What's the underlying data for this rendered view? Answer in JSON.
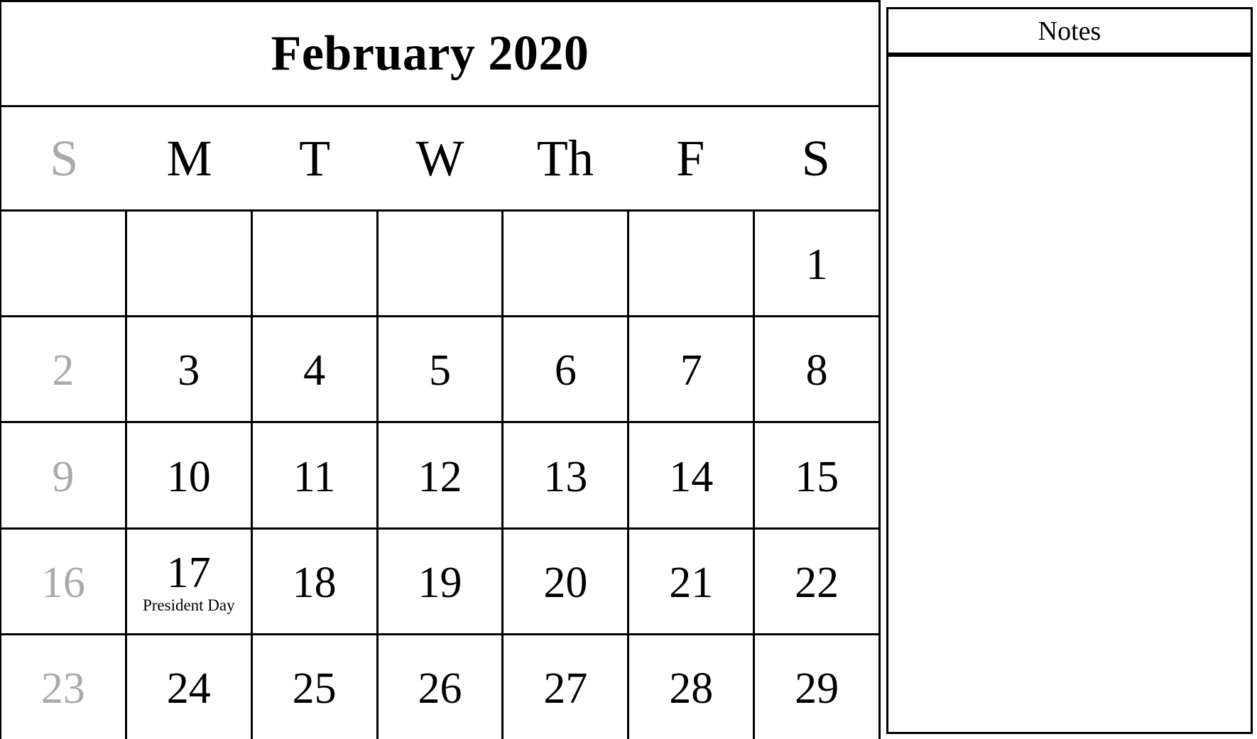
{
  "calendar": {
    "title": "February 2020",
    "weekdays": [
      {
        "label": "S",
        "weekend": true
      },
      {
        "label": "M",
        "weekend": false
      },
      {
        "label": "T",
        "weekend": false
      },
      {
        "label": "W",
        "weekend": false
      },
      {
        "label": "Th",
        "weekend": false
      },
      {
        "label": "F",
        "weekend": false
      },
      {
        "label": "S",
        "weekend": false
      }
    ],
    "weeks": [
      [
        {
          "day": ""
        },
        {
          "day": ""
        },
        {
          "day": ""
        },
        {
          "day": ""
        },
        {
          "day": ""
        },
        {
          "day": ""
        },
        {
          "day": "1"
        }
      ],
      [
        {
          "day": "2"
        },
        {
          "day": "3"
        },
        {
          "day": "4"
        },
        {
          "day": "5"
        },
        {
          "day": "6"
        },
        {
          "day": "7"
        },
        {
          "day": "8"
        }
      ],
      [
        {
          "day": "9"
        },
        {
          "day": "10"
        },
        {
          "day": "11"
        },
        {
          "day": "12"
        },
        {
          "day": "13"
        },
        {
          "day": "14"
        },
        {
          "day": "15"
        }
      ],
      [
        {
          "day": "16"
        },
        {
          "day": "17",
          "event": "President Day"
        },
        {
          "day": "18"
        },
        {
          "day": "19"
        },
        {
          "day": "20"
        },
        {
          "day": "21"
        },
        {
          "day": "22"
        }
      ],
      [
        {
          "day": "23"
        },
        {
          "day": "24"
        },
        {
          "day": "25"
        },
        {
          "day": "26"
        },
        {
          "day": "27"
        },
        {
          "day": "28"
        },
        {
          "day": "29"
        }
      ]
    ],
    "colors": {
      "grid_line": "#000000",
      "text": "#000000",
      "sunday_text": "#aaaaaa",
      "background": "#ffffff"
    }
  },
  "notes": {
    "title": "Notes",
    "content": ""
  }
}
